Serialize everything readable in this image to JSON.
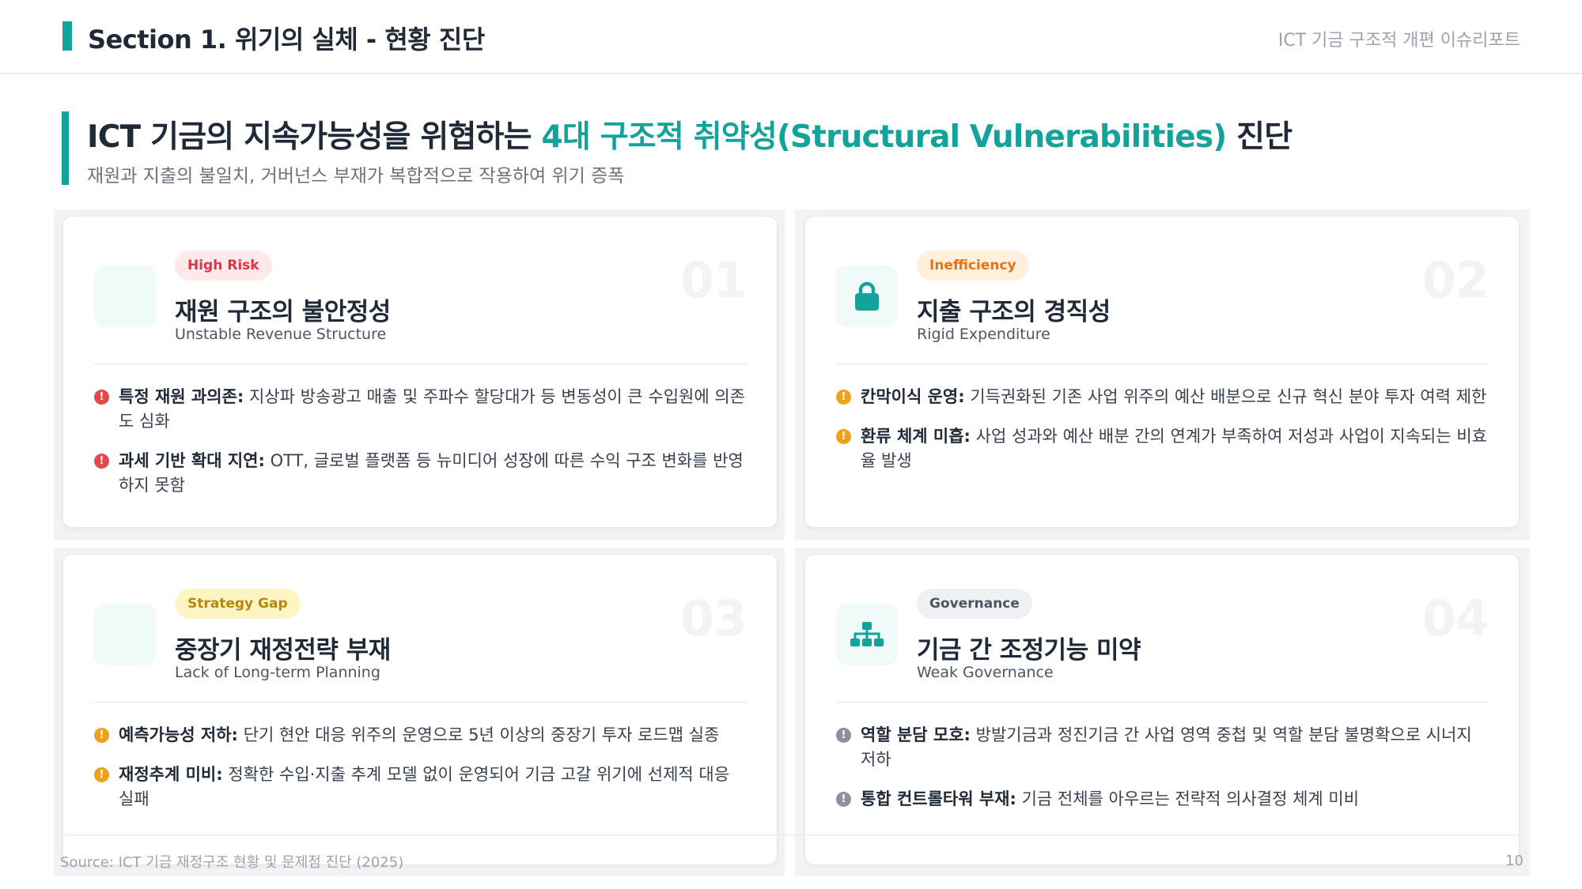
{
  "header": {
    "section_title": "Section 1. 위기의 실체 - 현황 진단",
    "report_name": "ICT 기금 구조적 개편 이슈리포트"
  },
  "headline": {
    "prefix": "ICT 기금의 지속가능성을 위협하는 ",
    "highlight": "4대 구조적 취약성(Structural Vulnerabilities)",
    "suffix": " 진단",
    "subtitle": "재원과 지출의 불일치, 거버넌스 부재가 복합적으로 작용하여 위기 증폭"
  },
  "colors": {
    "accent": "#14a39a",
    "risk": "#e5484d",
    "warning": "#f0a11b",
    "neutral": "#8c929c"
  },
  "cards": [
    {
      "number": "01",
      "badge": "High Risk",
      "icon": "blank-icon",
      "title": "재원 구조의 불안정성",
      "subtitle": "Unstable Revenue Structure",
      "points": [
        {
          "term": "특정 재원 과의존:",
          "text": " 지상파 방송광고 매출 및 주파수 할당대가 등 변동성이 큰 수입원에 의존도 심화"
        },
        {
          "term": "과세 기반 확대 지연:",
          "text": " OTT, 글로벌 플랫폼 등 뉴미디어 성장에 따른 수익 구조 변화를 반영하지 못함"
        }
      ]
    },
    {
      "number": "02",
      "badge": "Inefficiency",
      "icon": "lock-icon",
      "title": "지출 구조의 경직성",
      "subtitle": "Rigid Expenditure",
      "points": [
        {
          "term": "칸막이식 운영:",
          "text": " 기득권화된 기존 사업 위주의 예산 배분으로 신규 혁신 분야 투자 여력 제한"
        },
        {
          "term": "환류 체계 미흡:",
          "text": " 사업 성과와 예산 배분 간의 연계가 부족하여 저성과 사업이 지속되는 비효율 발생"
        }
      ]
    },
    {
      "number": "03",
      "badge": "Strategy Gap",
      "icon": "blank-icon",
      "title": "중장기 재정전략 부재",
      "subtitle": "Lack of Long-term Planning",
      "points": [
        {
          "term": "예측가능성 저하:",
          "text": " 단기 현안 대응 위주의 운영으로 5년 이상의 중장기 투자 로드맵 실종"
        },
        {
          "term": "재정추계 미비:",
          "text": " 정확한 수입·지출 추계 모델 없이 운영되어 기금 고갈 위기에 선제적 대응 실패"
        }
      ]
    },
    {
      "number": "04",
      "badge": "Governance",
      "icon": "org-chart-icon",
      "title": "기금 간 조정기능 미약",
      "subtitle": "Weak Governance",
      "points": [
        {
          "term": "역할 분담 모호:",
          "text": " 방발기금과 정진기금 간 사업 영역 중첩 및 역할 분담 불명확으로 시너지 저하"
        },
        {
          "term": "통합 컨트롤타워 부재:",
          "text": " 기금 전체를 아우르는 전략적 의사결정 체계 미비"
        }
      ]
    }
  ],
  "footer": {
    "source": "Source: ICT 기금 재정구조 현황 및 문제점 진단 (2025)",
    "page_number": "10"
  }
}
